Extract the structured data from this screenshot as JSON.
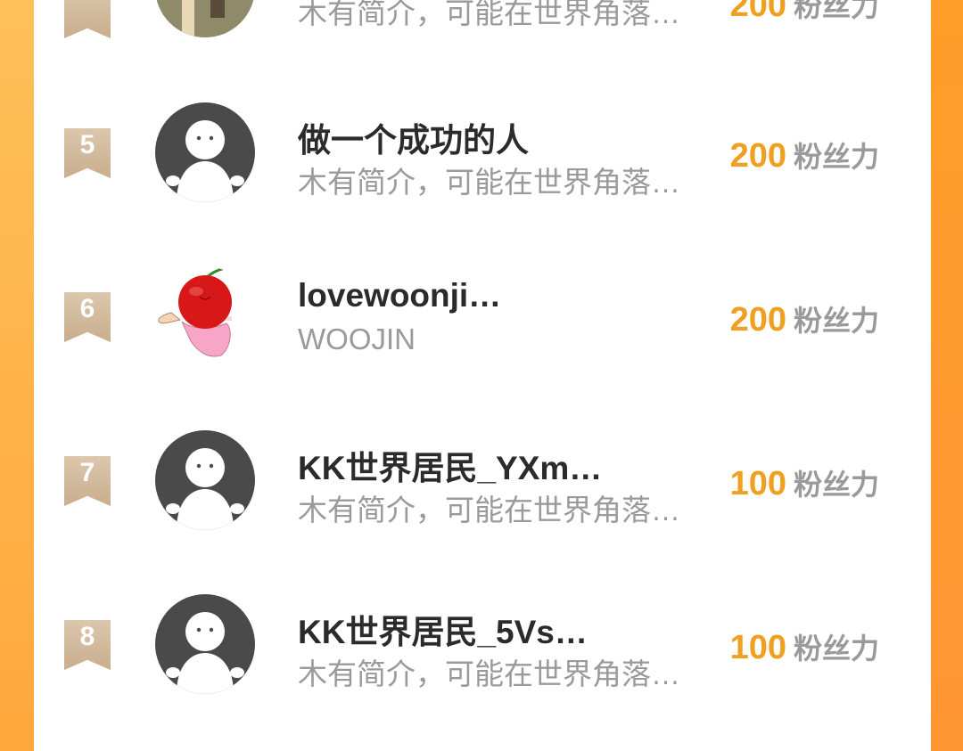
{
  "colors": {
    "accent": "#f0a020",
    "name_text": "#2b2b2b",
    "secondary_text": "#9a9a9a",
    "rank_badge": "#d4bb9c",
    "default_avatar": "#4a4a4a",
    "frame": "#ffa83c"
  },
  "ranking": [
    {
      "rank": "",
      "name": "",
      "bio": "木有简介，可能在世界角落…",
      "score": "200",
      "unit": "粉丝力",
      "avatar": "photo-avatar"
    },
    {
      "rank": "5",
      "name": "做一个成功的人",
      "bio": "木有简介，可能在世界角落…",
      "score": "200",
      "unit": "粉丝力",
      "avatar": "default-avatar"
    },
    {
      "rank": "6",
      "name": "lovewoonji…",
      "bio": "WOOJIN",
      "score": "200",
      "unit": "粉丝力",
      "avatar": "cherry-avatar"
    },
    {
      "rank": "7",
      "name": "KK世界居民_YXm…",
      "bio": "木有简介，可能在世界角落…",
      "score": "100",
      "unit": "粉丝力",
      "avatar": "default-avatar"
    },
    {
      "rank": "8",
      "name": "KK世界居民_5Vs…",
      "bio": "木有简介，可能在世界角落…",
      "score": "100",
      "unit": "粉丝力",
      "avatar": "default-avatar"
    }
  ]
}
